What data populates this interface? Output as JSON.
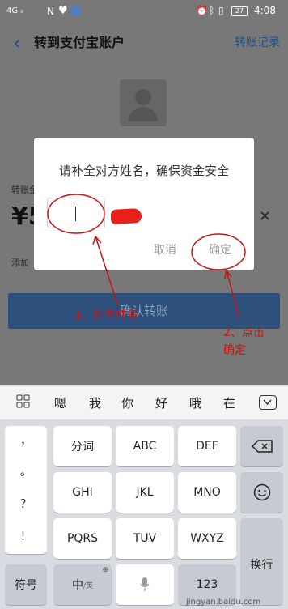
{
  "status_bar": {
    "signal": "4G ᵢₗ",
    "battery": "27",
    "time": "4:08"
  },
  "nav": {
    "title": "转到支付宝账户",
    "right_link": "转账记录"
  },
  "background": {
    "transfer_label": "转账金",
    "currency": "¥",
    "amount_fragment": "5",
    "add_note": "添加",
    "confirm_button": "确认转账",
    "close": "✕"
  },
  "dialog": {
    "title": "请补全对方姓名，确保资金安全",
    "cancel": "取消",
    "ok": "确定"
  },
  "annotations": {
    "step1": "1、补全姓名",
    "step2_line1": "2、点击",
    "step2_line2": "确定"
  },
  "keyboard": {
    "candidates": [
      "嗯",
      "我",
      "你",
      "好",
      "哦",
      "在"
    ],
    "side_keys": [
      "，",
      "。",
      "？",
      "！"
    ],
    "row1": [
      "分词",
      "ABC",
      "DEF"
    ],
    "row2": [
      "GHI",
      "JKL",
      "MNO"
    ],
    "row3": [
      "PQRS",
      "TUV",
      "WXYZ"
    ],
    "symbol_key": "符号",
    "lang_key": "中",
    "lang_sub": "/英",
    "globe": "⊕",
    "number_key": "123",
    "enter_key": "换行"
  },
  "watermark": "jingyan.baidu.com",
  "colors": {
    "accent": "#1b4f8d",
    "annotation_red": "#c81414"
  }
}
